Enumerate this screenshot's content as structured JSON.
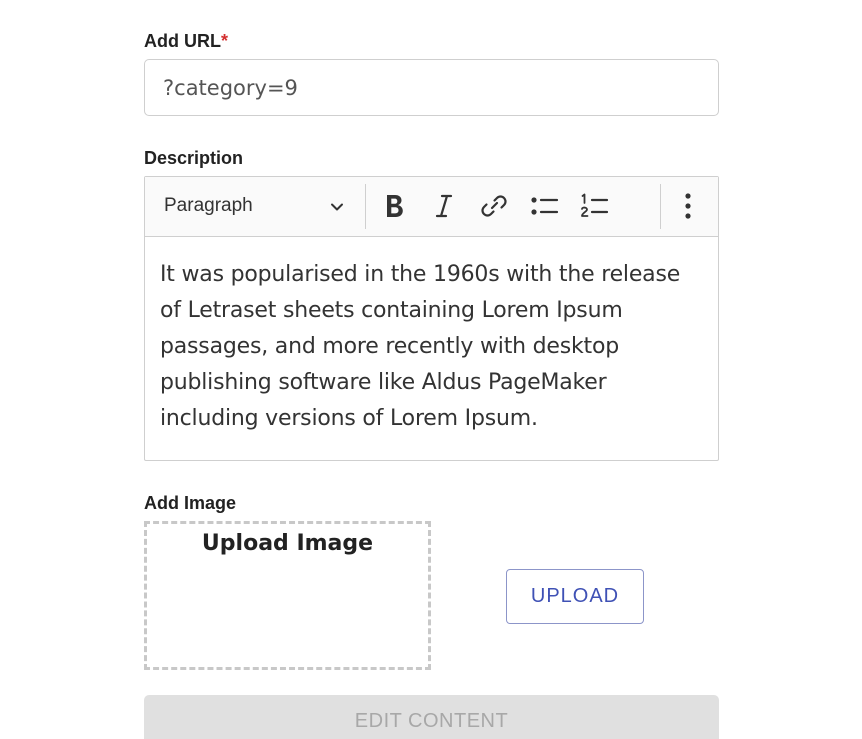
{
  "url_field": {
    "label": "Add URL",
    "required_mark": "*",
    "value": "?category=9"
  },
  "description": {
    "label": "Description",
    "toolbar": {
      "block_format": "Paragraph",
      "icons": [
        "chevron-down-icon",
        "bold-icon",
        "italic-icon",
        "link-icon",
        "bulleted-list-icon",
        "numbered-list-icon",
        "more-vertical-icon"
      ]
    },
    "content": "It was popularised in the 1960s with the release of Letraset sheets containing Lorem Ipsum passages, and more recently with desktop publishing software like Aldus PageMaker including versions of Lorem Ipsum."
  },
  "image": {
    "label": "Add Image",
    "dropzone_title": "Upload Image",
    "upload_label": "UPLOAD"
  },
  "submit": {
    "label": "EDIT CONTENT",
    "disabled": true
  },
  "colors": {
    "required": "#d32f2f",
    "primary": "#3f51b5",
    "disabled_bg": "#e0e0e0",
    "disabled_text": "#a8a8a8",
    "border": "#cfcfcf"
  }
}
